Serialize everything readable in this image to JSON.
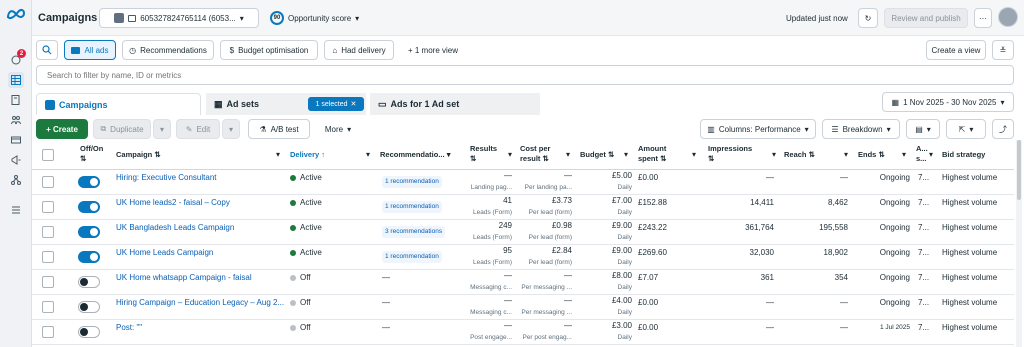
{
  "rail": {
    "notification_count": "2"
  },
  "topbar": {
    "title": "Campaigns",
    "account": "605327824765114 (6053...",
    "opportunity_score": "90",
    "opportunity_label": "Opportunity score",
    "updated": "Updated just now",
    "review_publish": "Review and publish",
    "more": "···"
  },
  "views": {
    "all_ads": "All ads",
    "recommendations": "Recommendations",
    "budget_optimisation": "Budget optimisation",
    "had_delivery": "Had delivery",
    "more_view": "+ 1 more view",
    "create_view": "Create a view"
  },
  "search": {
    "placeholder": "Search to filter by name, ID or metrics"
  },
  "tabs": {
    "campaigns": "Campaigns",
    "ad_sets": "Ad sets",
    "selected_badge": "1 selected",
    "ads": "Ads for 1 Ad set",
    "date_range": "1 Nov 2025 - 30 Nov 2025"
  },
  "toolbar": {
    "create": "+ Create",
    "duplicate": "Duplicate",
    "edit": "Edit",
    "ab_test": "A/B test",
    "more": "More",
    "columns": "Columns: Performance",
    "breakdown": "Breakdown"
  },
  "headers": {
    "offon": "Off/On",
    "campaign": "Campaign",
    "delivery": "Delivery",
    "recommendations": "Recommendatio...",
    "results": "Results",
    "cost_per_result_1": "Cost per",
    "cost_per_result_2": "result",
    "budget": "Budget",
    "amount_spent_1": "Amount",
    "amount_spent_2": "spent",
    "impressions": "Impressions",
    "reach": "Reach",
    "ends": "Ends",
    "attr_1": "A...",
    "attr_2": "s...",
    "bid_strategy": "Bid strategy",
    "sort_glyph": "⇅"
  },
  "rows": [
    {
      "on": true,
      "campaign": "Hiring: Executive Consultant",
      "delivery": "Active",
      "delivery_color": "#1d7a3e",
      "rec": "1 recommendation",
      "results": "—",
      "results_sub": "Landing pag...",
      "cost": "—",
      "cost_sub": "Per landing pa...",
      "budget": "£5.00",
      "budget_sub": "Daily",
      "spent": "£0.00",
      "impressions": "—",
      "reach": "—",
      "ends": "Ongoing",
      "attr": "7...",
      "bid": "Highest volume"
    },
    {
      "on": true,
      "campaign": "UK Home leads2 - faisal – Copy",
      "delivery": "Active",
      "delivery_color": "#1d7a3e",
      "rec": "1 recommendation",
      "results": "41",
      "results_sub": "Leads (Form)",
      "cost": "£3.73",
      "cost_sub": "Per lead (form)",
      "budget": "£7.00",
      "budget_sub": "Daily",
      "spent": "£152.88",
      "impressions": "14,411",
      "reach": "8,462",
      "ends": "Ongoing",
      "attr": "7...",
      "bid": "Highest volume"
    },
    {
      "on": true,
      "campaign": "UK Bangladesh Leads Campaign",
      "delivery": "Active",
      "delivery_color": "#1d7a3e",
      "rec": "3 recommendations",
      "results": "249",
      "results_sub": "Leads (Form)",
      "cost": "£0.98",
      "cost_sub": "Per lead (form)",
      "budget": "£9.00",
      "budget_sub": "Daily",
      "spent": "£243.22",
      "impressions": "361,764",
      "reach": "195,558",
      "ends": "Ongoing",
      "attr": "7...",
      "bid": "Highest volume"
    },
    {
      "on": true,
      "campaign": "UK Home Leads Campaign",
      "delivery": "Active",
      "delivery_color": "#1d7a3e",
      "rec": "1 recommendation",
      "results": "95",
      "results_sub": "Leads (Form)",
      "cost": "£2.84",
      "cost_sub": "Per lead (form)",
      "budget": "£9.00",
      "budget_sub": "Daily",
      "spent": "£269.60",
      "impressions": "32,030",
      "reach": "18,902",
      "ends": "Ongoing",
      "attr": "7...",
      "bid": "Highest volume"
    },
    {
      "on": false,
      "campaign": "UK Home whatsapp Campaign - faisal",
      "delivery": "Off",
      "delivery_color": "#bcc0c4",
      "rec": "—",
      "results": "—",
      "results_sub": "Messaging c...",
      "cost": "—",
      "cost_sub": "Per messaging ...",
      "budget": "£8.00",
      "budget_sub": "Daily",
      "spent": "£7.07",
      "impressions": "361",
      "reach": "354",
      "ends": "Ongoing",
      "attr": "7...",
      "bid": "Highest volume"
    },
    {
      "on": false,
      "campaign": "Hiring Campaign – Education Legacy – Aug 2...",
      "delivery": "Off",
      "delivery_color": "#bcc0c4",
      "rec": "—",
      "results": "—",
      "results_sub": "Messaging c...",
      "cost": "—",
      "cost_sub": "Per messaging ...",
      "budget": "£4.00",
      "budget_sub": "Daily",
      "spent": "£0.00",
      "impressions": "—",
      "reach": "—",
      "ends": "Ongoing",
      "attr": "7...",
      "bid": "Highest volume"
    },
    {
      "on": false,
      "campaign": "Post: \"\"",
      "delivery": "Off",
      "delivery_color": "#bcc0c4",
      "rec": "—",
      "results": "—",
      "results_sub": "Post engage...",
      "cost": "—",
      "cost_sub": "Per post engag...",
      "budget": "£3.00",
      "budget_sub": "Daily",
      "spent": "£0.00",
      "impressions": "—",
      "reach": "—",
      "ends": "1 Jul 2025",
      "attr": "7...",
      "bid": "Highest volume"
    }
  ],
  "colors": {
    "accent": "#0a78be",
    "link": "#0a5fb4",
    "create": "#1d7a3e"
  }
}
